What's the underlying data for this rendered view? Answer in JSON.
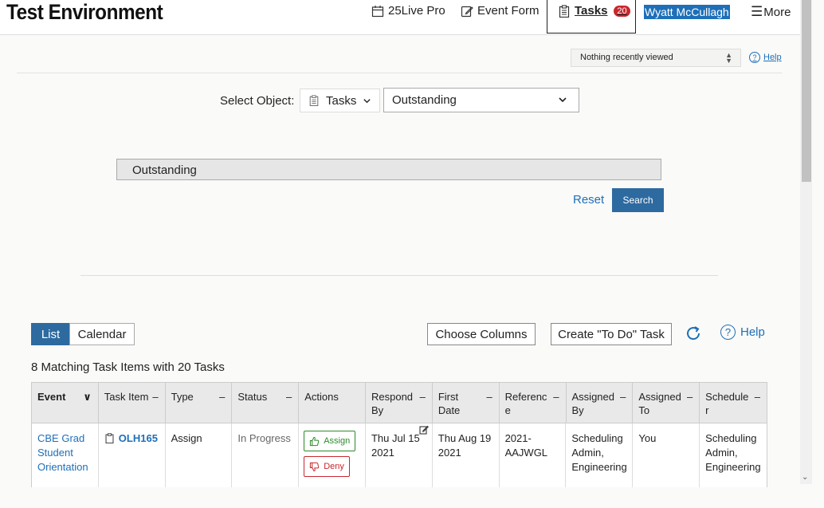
{
  "header": {
    "app_title": "Test Environment",
    "nav": {
      "pro_label": "25Live Pro",
      "event_form_label": "Event Form",
      "tasks_label": "Tasks",
      "tasks_badge": "20",
      "user_name": "Wyatt McCullagh",
      "more_label": "More"
    }
  },
  "recent": {
    "selected": "Nothing recently viewed",
    "help_label": "Help"
  },
  "search": {
    "select_object_label": "Select Object:",
    "object_value": "Tasks",
    "search_type_value": "Outstanding",
    "search_box_value": "Outstanding",
    "reset_label": "Reset",
    "search_button_label": "Search"
  },
  "results": {
    "view_list_label": "List",
    "view_calendar_label": "Calendar",
    "choose_columns_label": "Choose Columns",
    "create_todo_label": "Create \"To Do\" Task",
    "help_label": "Help",
    "match_count": "8 Matching Task Items with 20 Tasks"
  },
  "table": {
    "columns": [
      {
        "label": "Event",
        "suffix": "∨"
      },
      {
        "label": "Task Item",
        "suffix": "–"
      },
      {
        "label": "Type",
        "suffix": "–"
      },
      {
        "label": "Status",
        "suffix": "–"
      },
      {
        "label": "Actions",
        "suffix": ""
      },
      {
        "label": "Respond By",
        "suffix": "–"
      },
      {
        "label": "First Date",
        "suffix": "–"
      },
      {
        "label": "Referenc e",
        "suffix": "–"
      },
      {
        "label": "Assigned By",
        "suffix": "–"
      },
      {
        "label": "Assigned To",
        "suffix": "–"
      },
      {
        "label": "Schedule r",
        "suffix": "–"
      }
    ],
    "rows": [
      {
        "event": "CBE Grad Student Orientation",
        "task_item": "OLH165",
        "type": "Assign",
        "status": "In Progress",
        "assign_label": "Assign",
        "deny_label": "Deny",
        "respond_by": "Thu Jul 15 2021",
        "first_date": "Thu Aug 19 2021",
        "reference": "2021-AAJWGL",
        "assigned_by": "Scheduling Admin, Engineering",
        "assigned_to": "You",
        "scheduler": "Scheduling Admin, Engineering"
      }
    ]
  }
}
